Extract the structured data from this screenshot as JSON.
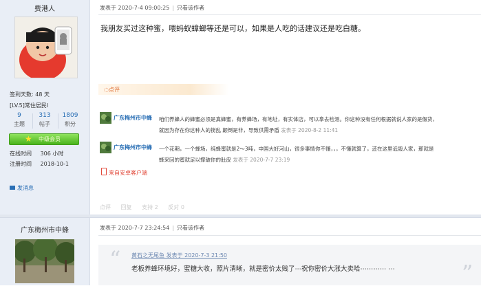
{
  "post1": {
    "username": "费港人",
    "stats": {
      "sign_days": "签到天数: 48 天",
      "level": "[LV.5]常住居民I"
    },
    "counts": [
      {
        "num": "9",
        "label": "主题"
      },
      {
        "num": "313",
        "label": "帖子"
      },
      {
        "num": "1809",
        "label": "积分"
      }
    ],
    "rank": "中级会员",
    "online_label": "在线时间",
    "online_value": "306 小时",
    "reg_label": "注册时间",
    "reg_value": "2018-10-1",
    "send_msg": "发消息",
    "meta_date": "发表于 2020-7-4 09:00:25",
    "meta_sep": "|",
    "meta_author_only": "只看该作者",
    "body": "我朋友买过这种蜜，喂蚂蚁蟑螂等还是可以，如果是人吃的话建议还是吃白糖。",
    "comment_tab": "点评",
    "replies": [
      {
        "name": "广东梅州市中蜂",
        "text": "咱们养蜂人的蜂蜜必须是真蜂蜜，有养蜂场，有地址，有实体店，可以拿去检测。你这种没有任何根据就说人家的是假货，",
        "text2": "就因为存在你这种人的搅乱 颠倒是非，导致供需矛盾",
        "time": "发表于 2020-8-2 11:41"
      },
      {
        "name": "广东梅州市中蜂",
        "text": "一个花期，一个蜂场，纯蜂蜜就是2～3吨，中国大好河山，很多事情你不懂，，，不懂就算了，还在这里诋毁人家，那就是",
        "text2": "蜂采回的蜜就足以撑破你的肚皮",
        "time": "发表于 2020-7-7 23:19"
      }
    ],
    "client_link": "来自安卓客户端",
    "actions": [
      "点评",
      "回复",
      "支持 2",
      "反对 0"
    ]
  },
  "post2": {
    "username": "广东梅州市中蜂",
    "meta_date": "发表于 2020-7-7 23:24:54",
    "meta_sep": "|",
    "meta_author_only": "只看该作者",
    "quote_author": "黄石之无尾鱼 发表于 2020-7-3 21:50",
    "quote_text": "老板养蜂环境好，蜜糖大收，照片清晰，就是密价太贱了⋯祝你密价大涨大卖哈⋯⋯⋯⋯ ⋯"
  },
  "colors": {
    "link": "#2a6fb5",
    "rank_green": "#4bb31d",
    "comment_orange": "#e0733a",
    "client_red": "#e24a3b"
  },
  "icons": {
    "avatar": "android-avatar",
    "msg": "envelope-icon",
    "phone": "phone-icon",
    "quote": "quote-mark-icon"
  }
}
